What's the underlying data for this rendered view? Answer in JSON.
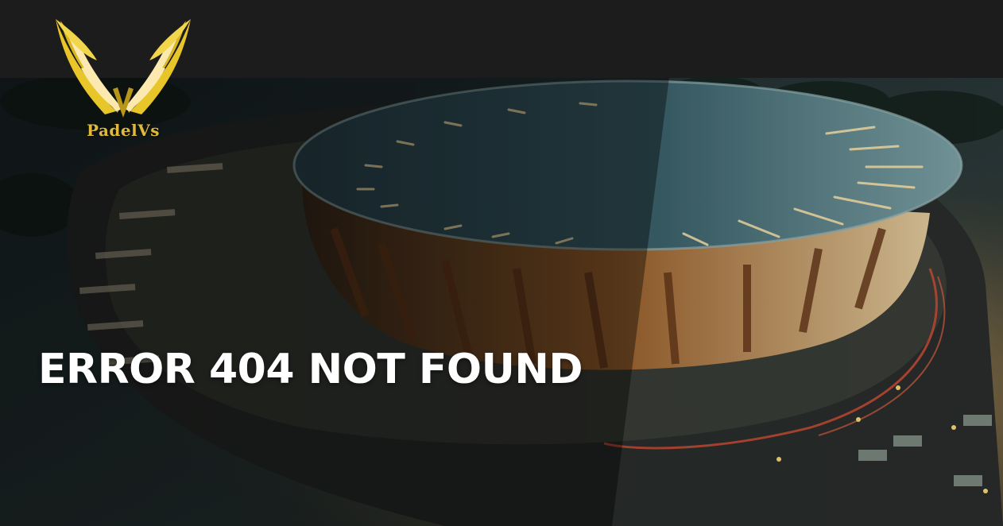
{
  "brand": {
    "logo_text": "PadelVs",
    "logo_icon": "winged-v-icon",
    "gold": "#e8c62a",
    "gold_dark": "#b8961a",
    "cream": "#fbe9b0"
  },
  "header": {
    "background": "#1c1c1c"
  },
  "hero": {
    "image": "stadium-at-night-illustration",
    "title": "ERROR 404 NOT FOUND"
  }
}
